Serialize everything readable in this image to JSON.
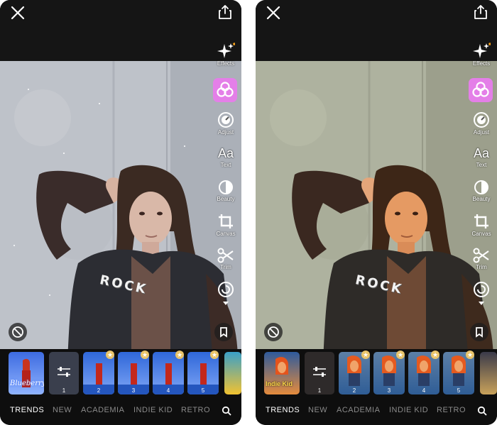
{
  "screens": [
    {
      "id": "left",
      "tools": [
        "Effects",
        "Adjust",
        "Text",
        "Beauty",
        "Canvas",
        "Trim"
      ],
      "text_tool_glyph": "Aa",
      "photo_text": "ROCK",
      "first_thumb_label": "Blueberry",
      "thumb_numbers": [
        "1",
        "2",
        "3",
        "4",
        "5"
      ],
      "tabs": [
        "TRENDS",
        "NEW",
        "ACADEMIA",
        "INDIE KID",
        "RETRO"
      ],
      "active_tab": "TRENDS",
      "colors": {
        "wall": "#c9ccd3",
        "skin": "#d9b8a8",
        "accent": "#e47fe8"
      }
    },
    {
      "id": "right",
      "tools": [
        "Effects",
        "Adjust",
        "Text",
        "Beauty",
        "Canvas",
        "Trim"
      ],
      "text_tool_glyph": "Aa",
      "photo_text": "ROCK",
      "first_thumb_label": "Indie Kid",
      "thumb_numbers": [
        "1",
        "2",
        "3",
        "4",
        "5"
      ],
      "tabs": [
        "TRENDS",
        "NEW",
        "ACADEMIA",
        "INDIE KID",
        "RETRO"
      ],
      "active_tab": "TRENDS",
      "colors": {
        "wall": "#b9bca8",
        "skin": "#e59a63",
        "accent": "#e47fe8"
      }
    }
  ],
  "icons": [
    "close-icon",
    "share-icon",
    "sparkle-icon",
    "filter-circles-icon",
    "adjust-dial-icon",
    "text-icon",
    "beauty-icon",
    "crop-icon",
    "scissors-icon",
    "redo-icon",
    "no-filter-icon",
    "bookmark-icon",
    "search-icon",
    "sliders-icon",
    "star-icon"
  ]
}
